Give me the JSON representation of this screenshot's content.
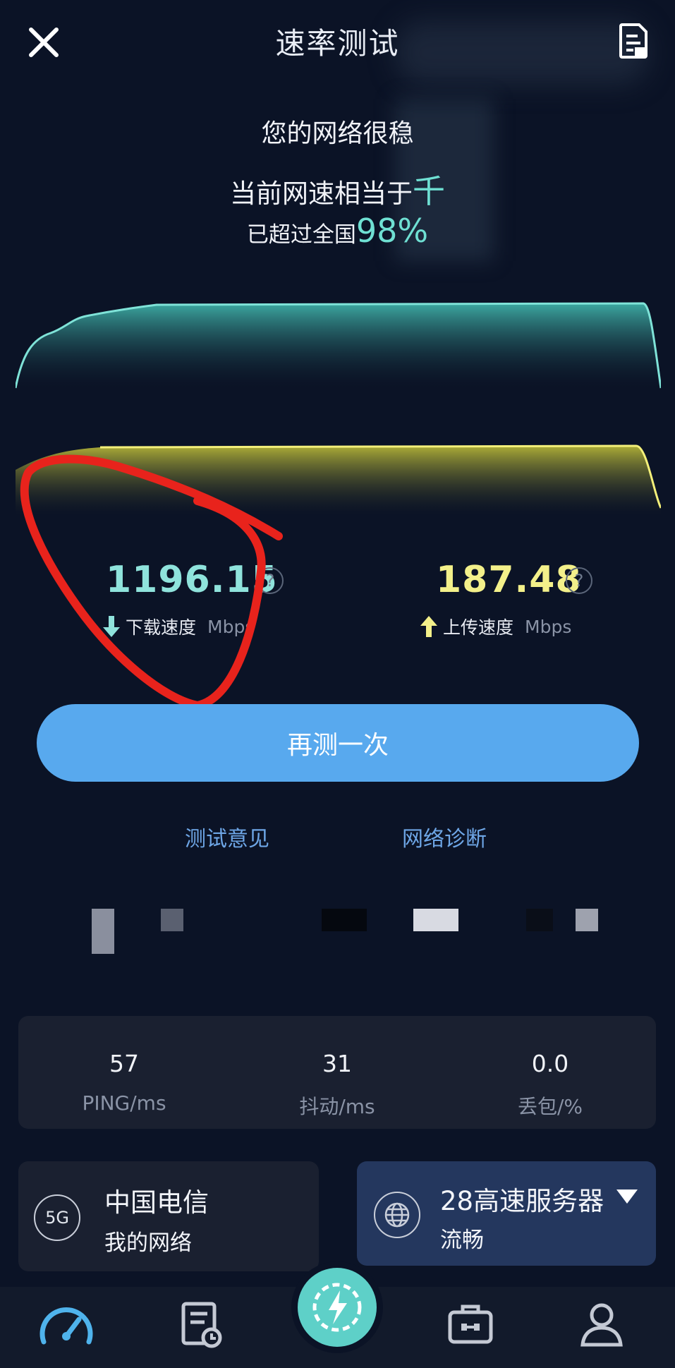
{
  "header": {
    "title": "速率测试",
    "close_icon": "close-icon",
    "report_icon": "report-icon"
  },
  "summary": {
    "line1": "您的网络很稳",
    "line2_prefix": "当前网速相当于",
    "line2_highlight": "千",
    "line3_prefix": "已超过全国",
    "line3_highlight": "98%"
  },
  "download": {
    "value": "1196.15",
    "label": "下载速度",
    "unit": "Mbps",
    "color": "#8fe3dc"
  },
  "upload": {
    "value": "187.48",
    "label": "上传速度",
    "unit": "Mbps",
    "color": "#f3f08a"
  },
  "help_glyph": "?",
  "actions": {
    "retest": "再测一次",
    "feedback": "测试意见",
    "diagnose": "网络诊断"
  },
  "stats": [
    {
      "value": "57",
      "label": "PING/ms"
    },
    {
      "value": "31",
      "label": "抖动/ms"
    },
    {
      "value": "0.0",
      "label": "丢包/%"
    }
  ],
  "network": {
    "badge": "5G",
    "carrier": "中国电信",
    "name": "我的网络"
  },
  "server": {
    "name": "28高速服务器",
    "status": "流畅"
  },
  "nav": {
    "center_icon": "speedometer-bolt-icon"
  },
  "colors": {
    "background": "#0b1326",
    "accent": "#58a9ee",
    "download": "#5ed0c8",
    "upload": "#e6e25a",
    "annotation": "#e8231c"
  }
}
